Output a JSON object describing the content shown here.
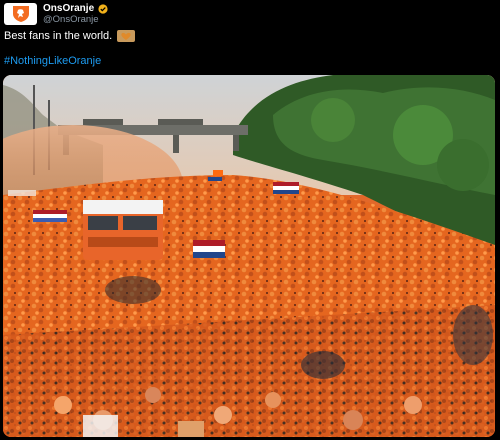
{
  "tweet": {
    "author": {
      "display_name": "OnsOranje",
      "handle": "@OnsOranje",
      "avatar_icon": "lion-crest-icon",
      "verified_icon": "verified-badge-icon",
      "verified_color": "#f2b21b"
    },
    "text": "Best fans in the world.",
    "emoji_icon": "orange-heart-icon",
    "hashtag": "#NothingLikeOranje",
    "hashtag_color": "#1d9bf0",
    "media": {
      "type": "photo",
      "icon": "photo-crowd-image",
      "brand_color": "#ff6a10"
    }
  }
}
